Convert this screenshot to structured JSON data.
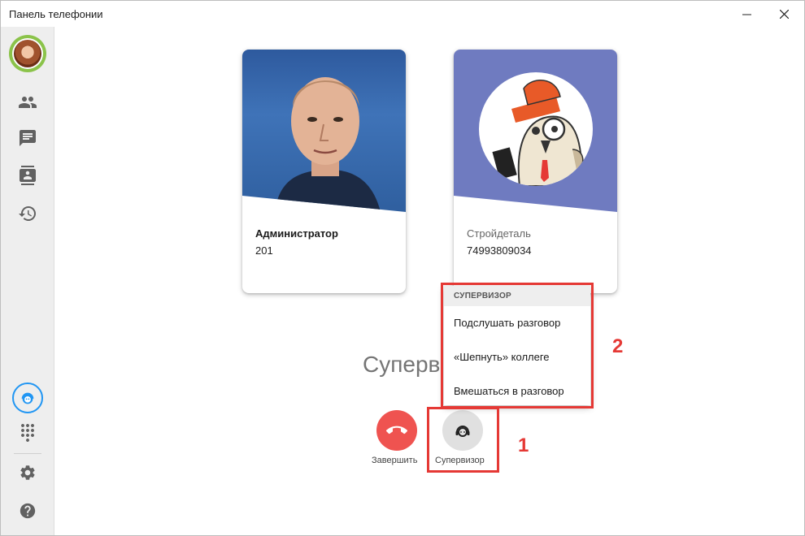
{
  "window": {
    "title": "Панель телефонии"
  },
  "cards": [
    {
      "name": "Администратор",
      "number": "201"
    },
    {
      "name": "Стройдеталь",
      "number": "74993809034"
    }
  ],
  "main": {
    "status_text": "Суперв"
  },
  "actions": {
    "end_label": "Завершить",
    "supervisor_label": "Супервизор"
  },
  "menu": {
    "header": "СУПЕРВИЗОР",
    "items": [
      "Подслушать разговор",
      "«Шепнуть» коллеге",
      "Вмешаться в разговор"
    ]
  },
  "annotations": {
    "one": "1",
    "two": "2"
  },
  "colors": {
    "accent": "#2196f3",
    "end_call": "#ef5350",
    "annotation": "#e53935",
    "avatar_ring": "#8bc34a"
  }
}
